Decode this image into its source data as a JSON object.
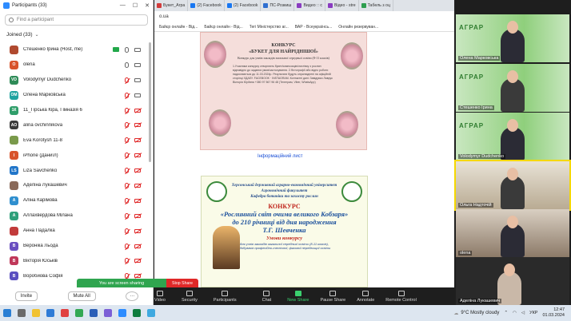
{
  "panel": {
    "title": "Participants (33)",
    "search_placeholder": "Find a participant",
    "joined_label": "Joined (33)",
    "invite_label": "Invite",
    "mute_all_label": "Mute All",
    "more_label": "···",
    "participants": [
      {
        "name": "Стешенко Ірина (Host, me)",
        "initials": "",
        "color": "#b04a2f",
        "mic": "on",
        "cam": "on",
        "sharing": true
      },
      {
        "name": "olena",
        "initials": "O",
        "color": "#d8542c",
        "mic": "on",
        "cam": "on"
      },
      {
        "name": "Volodymyr Dudchenko",
        "initials": "VD",
        "color": "#2e8b57",
        "mic": "muted",
        "cam": "on"
      },
      {
        "name": "Олена Марковська",
        "initials": "ОМ",
        "color": "#1fa3a0",
        "mic": "muted",
        "cam": "on"
      },
      {
        "name": "11_Гірська Кіра, Гімназія 6",
        "initials": "1К",
        "color": "#2f9e6a",
        "mic": "muted",
        "cam": "off"
      },
      {
        "name": "alina ovchinnikova",
        "initials": "AO",
        "color": "#3a3a3a",
        "mic": "muted",
        "cam": "off"
      },
      {
        "name": "Eva Korotysh 11-8",
        "initials": "",
        "color": "#7a9a4b",
        "mic": "muted",
        "cam": "off"
      },
      {
        "name": "iPhone (Даниїл)",
        "initials": "I",
        "color": "#d8542c",
        "mic": "muted",
        "cam": "off"
      },
      {
        "name": "Liza Savchenko",
        "initials": "LS",
        "color": "#2276c9",
        "mic": "muted",
        "cam": "off"
      },
      {
        "name": "Аделіна Лукашевич",
        "initials": "",
        "color": "#8a6a5a",
        "mic": "muted",
        "cam": "off"
      },
      {
        "name": "Аліна Карімова",
        "initials": "А",
        "color": "#2f8fcf",
        "mic": "muted",
        "cam": "off"
      },
      {
        "name": "Аллахвердова Мілана",
        "initials": "А",
        "color": "#2fa07a",
        "mic": "muted",
        "cam": "off"
      },
      {
        "name": "Анна Падалка",
        "initials": "",
        "color": "#c23b3b",
        "mic": "muted",
        "cam": "off"
      },
      {
        "name": "Вероніка Льода",
        "initials": "В",
        "color": "#6a4fc0",
        "mic": "muted",
        "cam": "off"
      },
      {
        "name": "Вікторія Юськів",
        "initials": "В",
        "color": "#c0385a",
        "mic": "muted",
        "cam": "off"
      },
      {
        "name": "Воробйова Софія",
        "initials": "В",
        "color": "#5a4fc0",
        "mic": "muted",
        "cam": "off"
      }
    ]
  },
  "browser": {
    "tabs": [
      {
        "label": "Букет_Агра",
        "color": "#d23c3c"
      },
      {
        "label": "(2) Facebook",
        "color": "#1877f2"
      },
      {
        "label": "(2) Facebook",
        "color": "#1877f2"
      },
      {
        "label": "ПС-Розкиш",
        "color": "#2f6fd0"
      },
      {
        "label": "Видео :: с",
        "color": "#8a3cc0"
      },
      {
        "label": "Відео - stre",
        "color": "#8a3cc0"
      },
      {
        "label": "Табель з оц",
        "color": "#2e9e4f"
      }
    ],
    "url": "о.ua",
    "bookmarks": [
      "Байєр онлайн - Від...",
      "Байєр онлайн - Від...",
      "Тегі Міністерство аг...",
      "ВАР - Всеукраїнсь...",
      "Онлайн резервуван..."
    ],
    "poster1": {
      "title_line1": "КОНКУРС",
      "title_line2": "«БУКЕТ ДЛЯ НАЙРІДНІШОЇ»",
      "title_line3": "Конкурс для учнів закладів загальної середньої освіти (8-11 класів)",
      "body": "1.Учасники конкурсу створюють букет/композицію/листівку з рослин відповідно до заданих умов/застосування. 2.Фотографії або відео роботи надсилаються до 11.03.2024р. Результати будуть оприлюднені на офіційній сторінці ХДАЕУ. FACEBOOK · INSTAGRAM. Контактні дані: Завідувач Лаврук Вікторія Юріївна +380 97 567 96 48 (Телеграм, Viber, WhatsApp)"
    },
    "info_link": "Інформаційний лист",
    "poster2": {
      "university": "Херсонський державний аграрно-економічний університет",
      "faculty": "Агрономічний факультет",
      "department": "Кафедра ботаніки та захисту рослин",
      "contest": "КОНКУРС",
      "theme_line1": "«Рослинний світ очима великого Кобзаря»",
      "theme_line2": "до 210 річниці від дня народження",
      "theme_line3": "Т.Г. Шевченка",
      "conditions": "Умови конкурсу",
      "body": "для учнів закладів загальної середньої освіти (8-11 класів), здобувачів професійно-технічної, фахової передвищої освіти"
    },
    "share_bar": {
      "sharing": "You are screen sharing",
      "stop": "Stop Share"
    }
  },
  "toolbar": [
    {
      "label": "Video",
      "green": false
    },
    {
      "label": "Security",
      "green": false
    },
    {
      "label": "Participants",
      "green": false
    },
    {
      "label": "Chat",
      "green": false
    },
    {
      "label": "New Share",
      "green": true
    },
    {
      "label": "Pause Share",
      "green": false
    },
    {
      "label": "Annotate",
      "green": false
    },
    {
      "label": "Remote Control",
      "green": false
    }
  ],
  "participants_count": "33",
  "videos": [
    {
      "name": "Олена Марковська",
      "type": "wall"
    },
    {
      "name": "Стешенко Ірина",
      "type": "wall"
    },
    {
      "name": "Volodymyr Dudchenko",
      "type": "wall"
    },
    {
      "name": "Ольга Надточій",
      "type": "office"
    },
    {
      "name": "olena",
      "type": "home"
    },
    {
      "name": "Аделіна Лукашевич",
      "type": "photo"
    }
  ],
  "wall_text": "АГРАР",
  "taskbar": {
    "weather_temp": "9°C",
    "weather_text": "Mostly cloudy",
    "lang": "УКР",
    "time": "12:47",
    "date": "01.03.2024"
  }
}
